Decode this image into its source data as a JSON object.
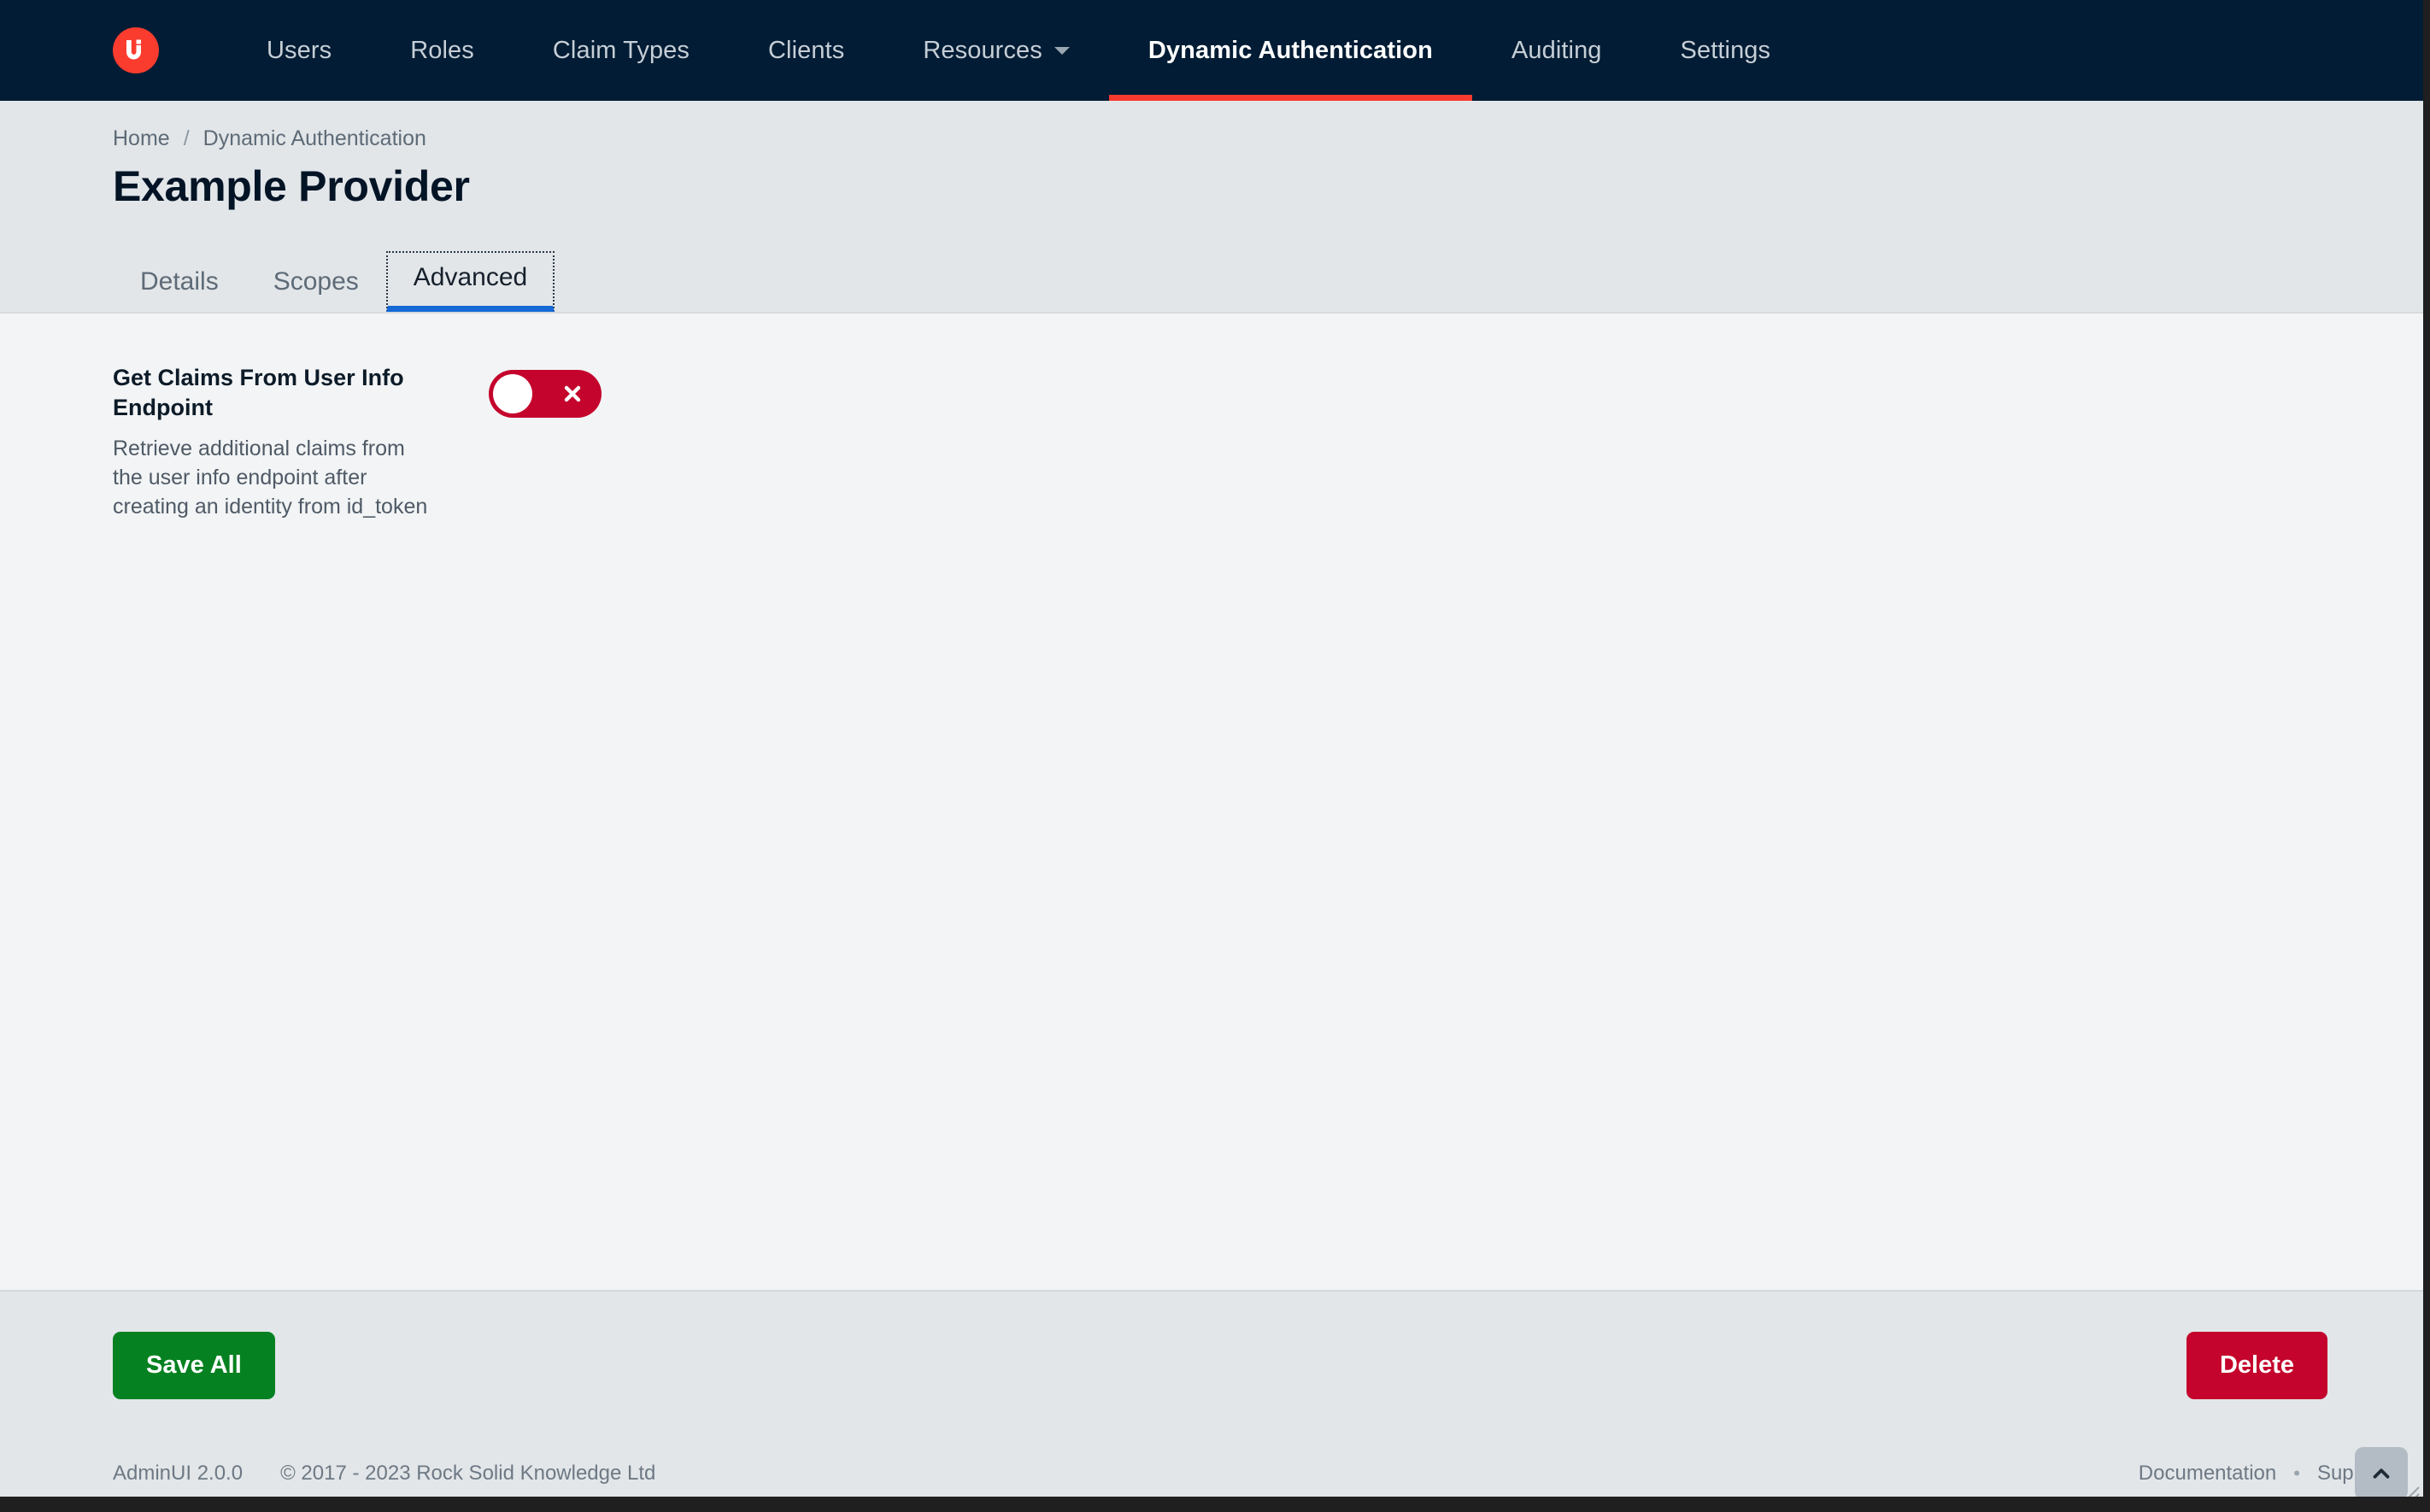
{
  "brand": {
    "logo_icon": "ui-logo-icon",
    "logo_text": "Ui",
    "logo_color": "#fa3c2e"
  },
  "navbar": {
    "background": "#011c34",
    "active_indicator_color": "#f93a2f",
    "items": [
      {
        "label": "Users",
        "active": false,
        "has_caret": false
      },
      {
        "label": "Roles",
        "active": false,
        "has_caret": false
      },
      {
        "label": "Claim Types",
        "active": false,
        "has_caret": false
      },
      {
        "label": "Clients",
        "active": false,
        "has_caret": false
      },
      {
        "label": "Resources",
        "active": false,
        "has_caret": true
      },
      {
        "label": "Dynamic Authentication",
        "active": true,
        "has_caret": false
      },
      {
        "label": "Auditing",
        "active": false,
        "has_caret": false
      },
      {
        "label": "Settings",
        "active": false,
        "has_caret": false
      }
    ]
  },
  "breadcrumb": {
    "home": "Home",
    "separator": "/",
    "current": "Dynamic Authentication"
  },
  "page": {
    "title": "Example Provider"
  },
  "tabs": {
    "active_underline_color": "#1669d6",
    "items": [
      {
        "label": "Details",
        "active": false
      },
      {
        "label": "Scopes",
        "active": false
      },
      {
        "label": "Advanced",
        "active": true
      }
    ]
  },
  "settings": [
    {
      "label": "Get Claims From User Info Endpoint",
      "description": "Retrieve additional claims from the user info endpoint after creating an identity from id_token",
      "toggle": {
        "state": "off",
        "icon": "cross-icon",
        "color": "#c4042c"
      }
    }
  ],
  "actions": {
    "save_label": "Save All",
    "save_color": "#068121",
    "delete_label": "Delete",
    "delete_color": "#c4042c"
  },
  "status_bar": {
    "version": "AdminUI 2.0.0",
    "copyright": "© 2017 - 2023 Rock Solid Knowledge Ltd",
    "documentation_label": "Documentation",
    "separator_dot": "•",
    "support_label": "Support",
    "scroll_top_icon": "chevron-up-icon"
  }
}
